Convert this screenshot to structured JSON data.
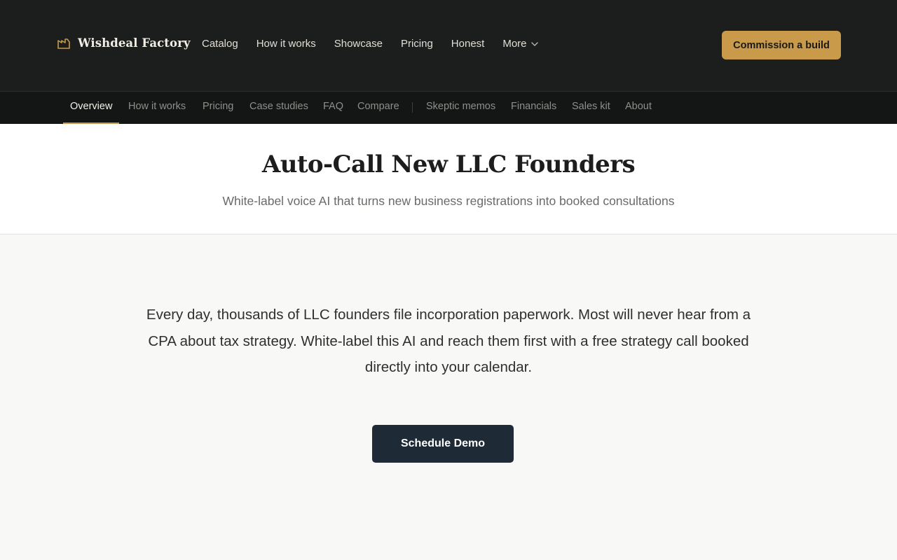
{
  "brand": {
    "name": "Wishdeal Factory",
    "icon": "factory-icon",
    "accent": "#c89a4a"
  },
  "nav": {
    "items": [
      "Catalog",
      "How it works",
      "Showcase",
      "Pricing",
      "Honest"
    ],
    "more_label": "More"
  },
  "cta": {
    "label": "Commission a build"
  },
  "subnav": {
    "items": [
      "Overview",
      "How it works",
      "Pricing",
      "Case studies",
      "FAQ",
      "Compare",
      "Skeptic memos",
      "Financials",
      "Sales kit",
      "About"
    ],
    "active": "Overview"
  },
  "hero": {
    "title": "Auto-Call New LLC Founders",
    "subtitle": "White-label voice AI that turns new business registrations into booked consultations"
  },
  "content": {
    "body": "Every day, thousands of LLC founders file incorporation paperwork. Most will never hear from a CPA about tax strategy. White-label this AI and reach them first with a free strategy call booked directly into your calendar.",
    "button_label": "Schedule Demo"
  }
}
